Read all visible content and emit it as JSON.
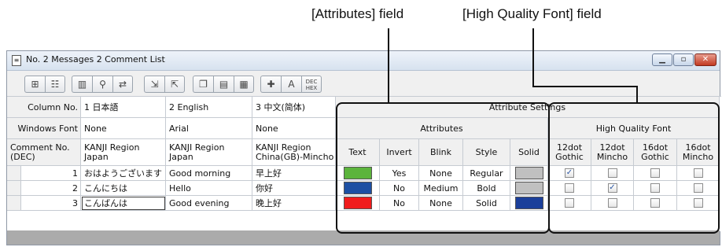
{
  "callouts": {
    "attributes_field": "[Attributes] field",
    "hqfont_field": "[High Quality Font] field"
  },
  "window": {
    "title": "No. 2 Messages 2 Comment List",
    "icon": "document-icon",
    "controls": [
      "minimize-icon",
      "maximize-icon",
      "close-icon"
    ]
  },
  "toolbar": {
    "buttons": [
      "insert-row-icon",
      "delete-row-icon",
      "column-settings-icon",
      "find-icon",
      "replace-icon",
      "import-icon",
      "export-icon",
      "copy-icon",
      "paste-icon",
      "list-icon",
      "add-comment-icon",
      "font-icon",
      "dec-hex-icon"
    ],
    "dechex_top": "DEC",
    "dechex_bottom": "HEX"
  },
  "grid": {
    "row_labels": {
      "column_no": "Column No.",
      "windows_font": "Windows Font",
      "comment_no": "Comment No.\n(DEC)"
    },
    "columns": [
      {
        "number": "1 日本語",
        "font": "None",
        "region": "KANJI Region\nJapan"
      },
      {
        "number": "2 English",
        "font": "Arial",
        "region": "KANJI Region\nJapan"
      },
      {
        "number": "3 中文(简体)",
        "font": "None",
        "region": "KANJI Region\nChina(GB)-Mincho"
      }
    ],
    "attr_settings_label": "Attribute Settings",
    "attributes_label": "Attributes",
    "hqfont_label": "High Quality Font",
    "attr_cols": [
      "Text",
      "Invert",
      "Blink",
      "Style",
      "Solid"
    ],
    "hq_cols": [
      "12dot\nGothic",
      "12dot\nMincho",
      "16dot\nGothic",
      "16dot\nMincho"
    ],
    "rows": [
      {
        "no": "1",
        "c1": "おはようございます",
        "c2": "Good morning",
        "c3": "早上好",
        "text_color": "#5cb43c",
        "invert": "Yes",
        "blink": "None",
        "style": "Regular",
        "solid_color": "#c0c0c0",
        "hq": [
          true,
          false,
          false,
          false
        ]
      },
      {
        "no": "2",
        "c1": "こんにちは",
        "c2": "Hello",
        "c3": "你好",
        "text_color": "#1c4fa3",
        "invert": "No",
        "blink": "Medium",
        "style": "Bold",
        "solid_color": "#c0c0c0",
        "hq": [
          false,
          true,
          false,
          false
        ]
      },
      {
        "no": "3",
        "c1": "こんばんは",
        "c2": "Good evening",
        "c3": "晚上好",
        "text_color": "#f01c1c",
        "invert": "No",
        "blink": "None",
        "style": "Solid",
        "solid_color": "#1b3f9a",
        "hq": [
          false,
          false,
          false,
          false
        ]
      }
    ]
  }
}
